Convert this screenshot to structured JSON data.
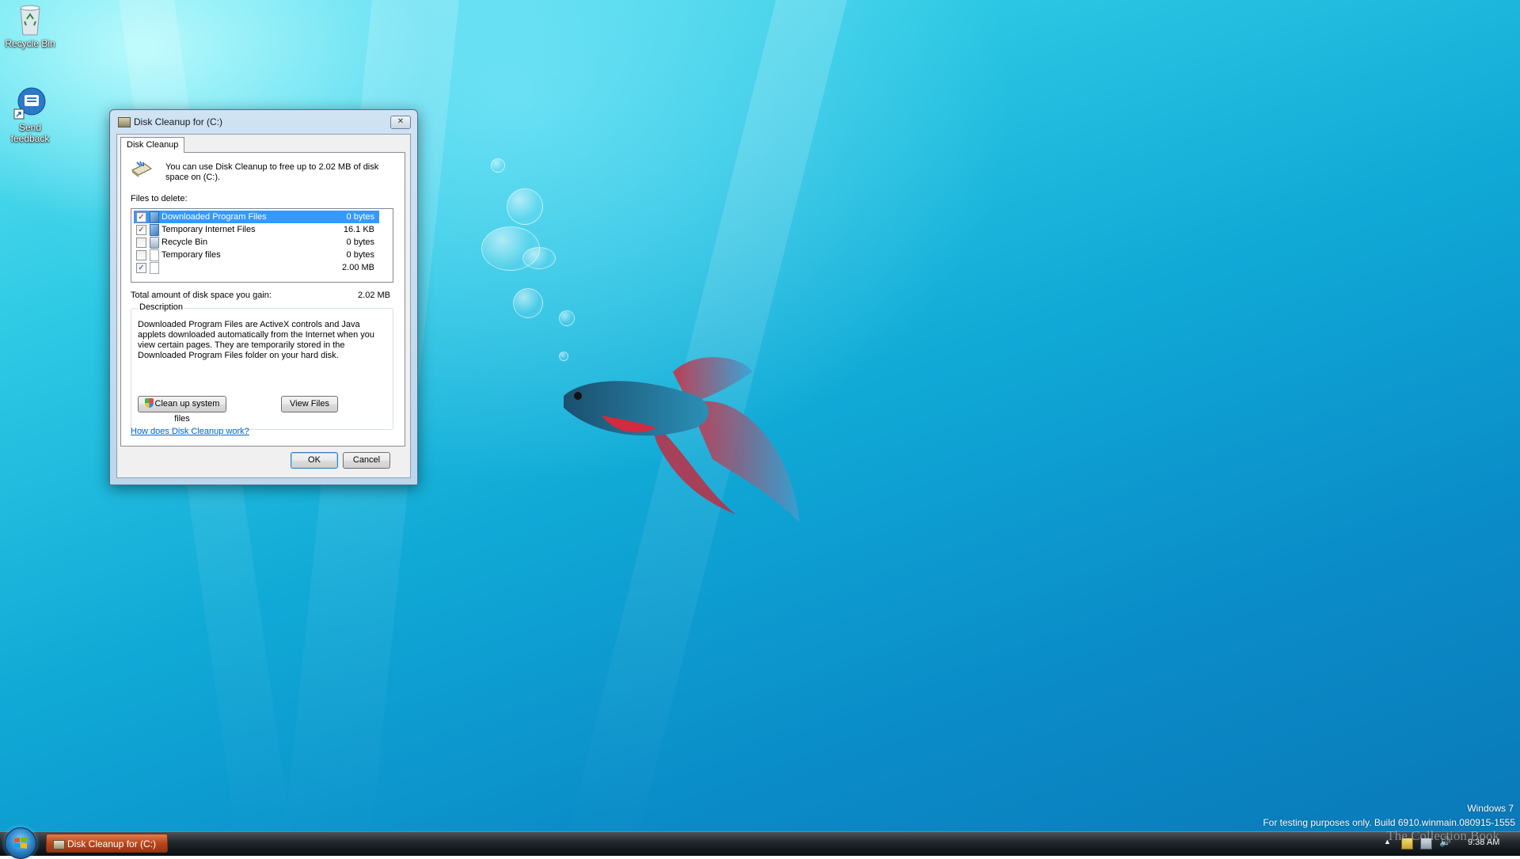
{
  "desktop": {
    "icons": [
      {
        "label": "Recycle Bin",
        "icon": "recycle-bin-icon"
      },
      {
        "label": "Send feedback",
        "icon": "send-feedback-icon"
      }
    ]
  },
  "window": {
    "title": "Disk Cleanup for  (C:)",
    "close_glyph": "✕",
    "tab": "Disk Cleanup",
    "intro": "You can use Disk Cleanup to free up to 2.02 MB of disk space on  (C:).",
    "files_label": "Files to delete:",
    "files": [
      {
        "checked": true,
        "name": "Downloaded Program Files",
        "size": "0 bytes",
        "selected": true,
        "icon": "ie-folder-icon"
      },
      {
        "checked": true,
        "name": "Temporary Internet Files",
        "size": "16.1 KB",
        "selected": false,
        "icon": "ie-folder-icon"
      },
      {
        "checked": false,
        "name": "Recycle Bin",
        "size": "0 bytes",
        "selected": false,
        "icon": "recycle-bin-icon"
      },
      {
        "checked": false,
        "name": "Temporary files",
        "size": "0 bytes",
        "selected": false,
        "icon": "blank-file-icon"
      },
      {
        "checked": true,
        "name": "",
        "size": "2.00 MB",
        "selected": false,
        "icon": "blank-file-icon"
      }
    ],
    "total_label": "Total amount of disk space you gain:",
    "total_value": "2.02 MB",
    "description_title": "Description",
    "description_text": "Downloaded Program Files are ActiveX controls and Java applets downloaded automatically from the Internet when you view certain pages. They are temporarily stored in the Downloaded Program Files folder on your hard disk.",
    "cleanup_system_label": "Clean up system files",
    "view_files_label": "View Files",
    "help_link": "How does Disk Cleanup work?",
    "ok_label": "OK",
    "cancel_label": "Cancel"
  },
  "taskbar": {
    "task_label": "Disk Cleanup for  (C:)",
    "clock": "9:38 AM"
  },
  "watermark": {
    "os_name": "Windows 7",
    "build_text": "For testing purposes only. Build 6910.winmain.080915-1555",
    "overlay": "The Collection Book"
  },
  "colors": {
    "selection": "#3399ff",
    "link": "#0066cc",
    "task_button": "#b9471d"
  }
}
